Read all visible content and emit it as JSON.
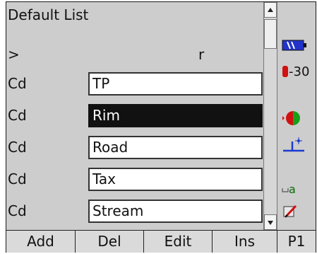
{
  "title": "Default List",
  "header": {
    "left": ">",
    "right": "r"
  },
  "rows": [
    {
      "code": "Cd",
      "value": "TP",
      "selected": false
    },
    {
      "code": "Cd",
      "value": "Rim",
      "selected": true
    },
    {
      "code": "Cd",
      "value": "Road",
      "selected": false
    },
    {
      "code": "Cd",
      "value": "Tax",
      "selected": false
    },
    {
      "code": "Cd",
      "value": "Stream",
      "selected": false
    }
  ],
  "status": {
    "battery_icon": "battery-icon",
    "battery_level": "-30",
    "signal_icon": "signal-icon",
    "antenna_icon": "antenna-icon",
    "input_mode_label": "a",
    "edit_icon": "edit-pen-icon",
    "colors": {
      "battery": "#2233cc",
      "red": "#d11111",
      "green": "#18a018",
      "blue": "#1a3ad0"
    }
  },
  "toolbar": {
    "add": "Add",
    "del": "Del",
    "edit": "Edit",
    "ins": "Ins",
    "page": "P1"
  }
}
